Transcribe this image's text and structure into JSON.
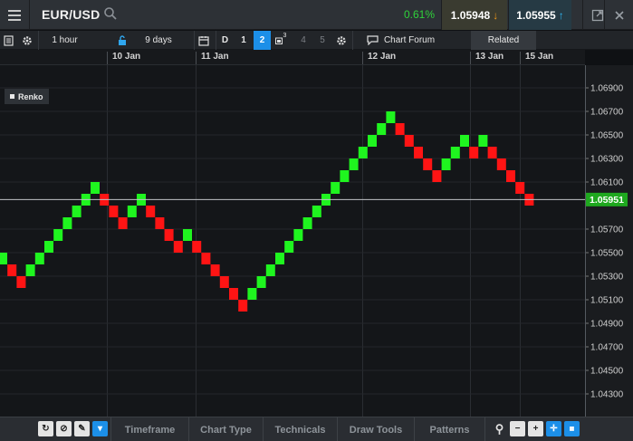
{
  "header": {
    "symbol": "EUR/USD",
    "change": "0.61%",
    "bid": "1.05948",
    "ask": "1.05955"
  },
  "toolbar": {
    "interval": "1 hour",
    "range": "9 days",
    "period_letter": "D",
    "layout_options": [
      "1",
      "2",
      "3",
      "4",
      "5"
    ],
    "layout_active": "2",
    "chart_forum": "Chart Forum",
    "related": "Related"
  },
  "date_axis": [
    "10 Jan",
    "11 Jan",
    "12 Jan",
    "13 Jan",
    "15 Jan"
  ],
  "chart_data": {
    "type": "renko",
    "legend": "Renko",
    "box_size": 0.001,
    "y_ticks": [
      "1.06900",
      "1.06700",
      "1.06500",
      "1.06300",
      "1.06100",
      "1.05700",
      "1.05500",
      "1.05300",
      "1.05100",
      "1.04900",
      "1.04700",
      "1.04500",
      "1.04300"
    ],
    "current_price": "1.05951",
    "colors": {
      "up": "#1ff51f",
      "down": "#ff1414"
    },
    "bricks": [
      {
        "dir": "up",
        "low": 1.054,
        "high": 1.055
      },
      {
        "dir": "down",
        "low": 1.053,
        "high": 1.054
      },
      {
        "dir": "down",
        "low": 1.052,
        "high": 1.053
      },
      {
        "dir": "up",
        "low": 1.053,
        "high": 1.054
      },
      {
        "dir": "up",
        "low": 1.054,
        "high": 1.055
      },
      {
        "dir": "up",
        "low": 1.055,
        "high": 1.056
      },
      {
        "dir": "up",
        "low": 1.056,
        "high": 1.057
      },
      {
        "dir": "up",
        "low": 1.057,
        "high": 1.058
      },
      {
        "dir": "up",
        "low": 1.058,
        "high": 1.059
      },
      {
        "dir": "up",
        "low": 1.059,
        "high": 1.06
      },
      {
        "dir": "up",
        "low": 1.06,
        "high": 1.061
      },
      {
        "dir": "down",
        "low": 1.059,
        "high": 1.06
      },
      {
        "dir": "down",
        "low": 1.058,
        "high": 1.059
      },
      {
        "dir": "down",
        "low": 1.057,
        "high": 1.058
      },
      {
        "dir": "up",
        "low": 1.058,
        "high": 1.059
      },
      {
        "dir": "up",
        "low": 1.059,
        "high": 1.06
      },
      {
        "dir": "down",
        "low": 1.058,
        "high": 1.059
      },
      {
        "dir": "down",
        "low": 1.057,
        "high": 1.058
      },
      {
        "dir": "down",
        "low": 1.056,
        "high": 1.057
      },
      {
        "dir": "down",
        "low": 1.055,
        "high": 1.056
      },
      {
        "dir": "up",
        "low": 1.056,
        "high": 1.057
      },
      {
        "dir": "down",
        "low": 1.055,
        "high": 1.056
      },
      {
        "dir": "down",
        "low": 1.054,
        "high": 1.055
      },
      {
        "dir": "down",
        "low": 1.053,
        "high": 1.054
      },
      {
        "dir": "down",
        "low": 1.052,
        "high": 1.053
      },
      {
        "dir": "down",
        "low": 1.051,
        "high": 1.052
      },
      {
        "dir": "down",
        "low": 1.05,
        "high": 1.051
      },
      {
        "dir": "up",
        "low": 1.051,
        "high": 1.052
      },
      {
        "dir": "up",
        "low": 1.052,
        "high": 1.053
      },
      {
        "dir": "up",
        "low": 1.053,
        "high": 1.054
      },
      {
        "dir": "up",
        "low": 1.054,
        "high": 1.055
      },
      {
        "dir": "up",
        "low": 1.055,
        "high": 1.056
      },
      {
        "dir": "up",
        "low": 1.056,
        "high": 1.057
      },
      {
        "dir": "up",
        "low": 1.057,
        "high": 1.058
      },
      {
        "dir": "up",
        "low": 1.058,
        "high": 1.059
      },
      {
        "dir": "up",
        "low": 1.059,
        "high": 1.06
      },
      {
        "dir": "up",
        "low": 1.06,
        "high": 1.061
      },
      {
        "dir": "up",
        "low": 1.061,
        "high": 1.062
      },
      {
        "dir": "up",
        "low": 1.062,
        "high": 1.063
      },
      {
        "dir": "up",
        "low": 1.063,
        "high": 1.064
      },
      {
        "dir": "up",
        "low": 1.064,
        "high": 1.065
      },
      {
        "dir": "up",
        "low": 1.065,
        "high": 1.066
      },
      {
        "dir": "up",
        "low": 1.066,
        "high": 1.067
      },
      {
        "dir": "down",
        "low": 1.065,
        "high": 1.066
      },
      {
        "dir": "down",
        "low": 1.064,
        "high": 1.065
      },
      {
        "dir": "down",
        "low": 1.063,
        "high": 1.064
      },
      {
        "dir": "down",
        "low": 1.062,
        "high": 1.063
      },
      {
        "dir": "down",
        "low": 1.061,
        "high": 1.062
      },
      {
        "dir": "up",
        "low": 1.062,
        "high": 1.063
      },
      {
        "dir": "up",
        "low": 1.063,
        "high": 1.064
      },
      {
        "dir": "up",
        "low": 1.064,
        "high": 1.065
      },
      {
        "dir": "down",
        "low": 1.063,
        "high": 1.064
      },
      {
        "dir": "up",
        "low": 1.064,
        "high": 1.065
      },
      {
        "dir": "down",
        "low": 1.063,
        "high": 1.064
      },
      {
        "dir": "down",
        "low": 1.062,
        "high": 1.063
      },
      {
        "dir": "down",
        "low": 1.061,
        "high": 1.062
      },
      {
        "dir": "down",
        "low": 1.06,
        "high": 1.061
      },
      {
        "dir": "down",
        "low": 1.059,
        "high": 1.06
      }
    ]
  },
  "bottom_bar": {
    "tabs": [
      "Timeframe",
      "Chart Type",
      "Technicals",
      "Draw Tools",
      "Patterns"
    ],
    "icons": [
      "refresh-icon",
      "block-icon",
      "pencil-icon",
      "dropdown-icon",
      "zoom-icon",
      "zoom-out-icon",
      "zoom-in-icon",
      "crosshair-icon",
      "log-scale-icon"
    ]
  }
}
